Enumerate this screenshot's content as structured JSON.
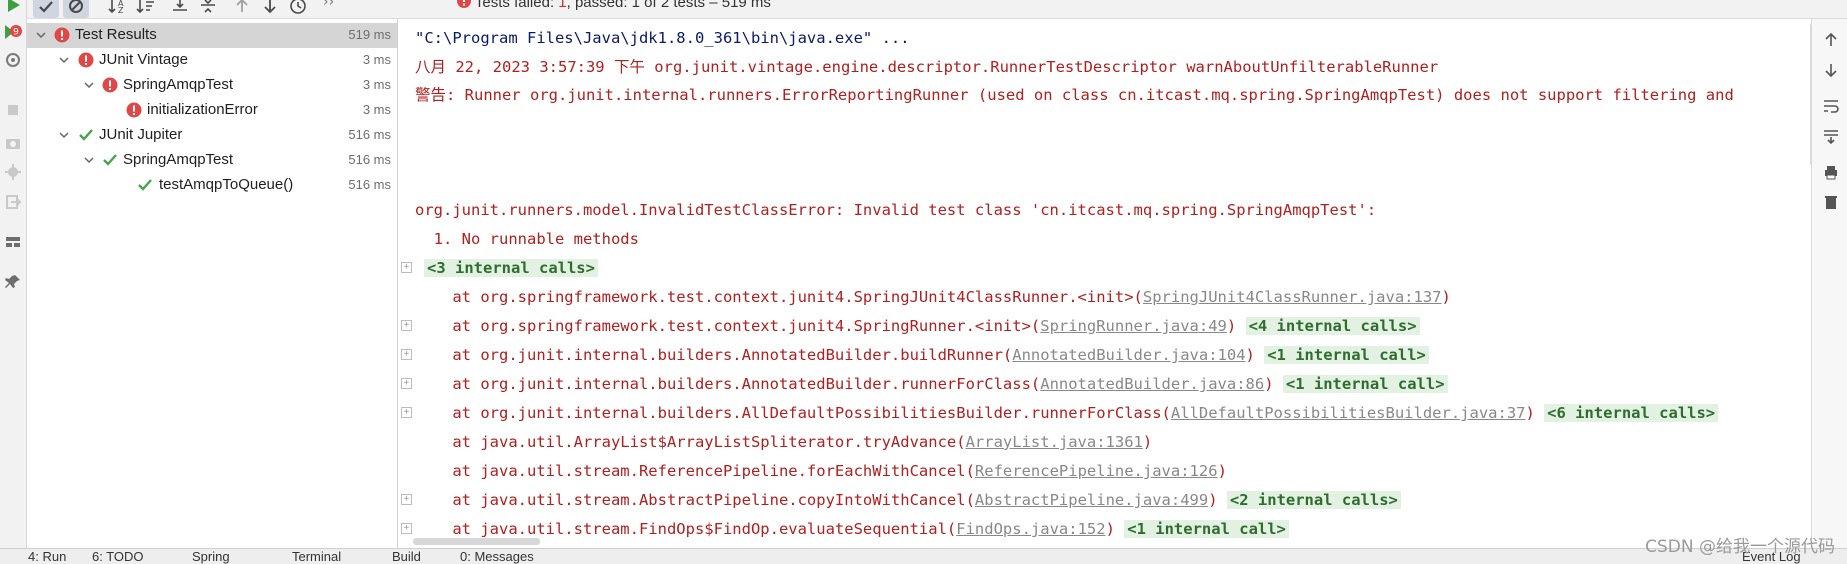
{
  "toolbar": {
    "status_prefix": "Tests failed: ",
    "failed_count": "1",
    "status_middle": ", passed: ",
    "passed_count": "1",
    "status_suffix": " of 2 tests – 519 ms"
  },
  "tree": {
    "rows": [
      {
        "label": "Test Results",
        "duration": "519 ms",
        "status": "failed"
      },
      {
        "label": "JUnit Vintage",
        "duration": "3 ms",
        "status": "failed"
      },
      {
        "label": "SpringAmqpTest",
        "duration": "3 ms",
        "status": "failed"
      },
      {
        "label": "initializationError",
        "duration": "3 ms",
        "status": "failed"
      },
      {
        "label": "JUnit Jupiter",
        "duration": "516 ms",
        "status": "passed"
      },
      {
        "label": "SpringAmqpTest",
        "duration": "516 ms",
        "status": "passed"
      },
      {
        "label": "testAmqpToQueue()",
        "duration": "516 ms",
        "status": "passed"
      }
    ]
  },
  "console": {
    "cmd": "\"C:\\Program Files\\Java\\jdk1.8.0_361\\bin\\java.exe\" ...",
    "warn1": "八月 22, 2023 3:57:39 下午 org.junit.vintage.engine.descriptor.RunnerTestDescriptor warnAboutUnfilterableRunner",
    "warn2": "警告: Runner org.junit.internal.runners.ErrorReportingRunner (used on class cn.itcast.mq.spring.SpringAmqpTest) does not support filtering and",
    "error": "org.junit.runners.model.InvalidTestClassError: Invalid test class 'cn.itcast.mq.spring.SpringAmqpTest':",
    "reason": "  1. No runnable methods",
    "internal_first": "<3 internal calls>",
    "frames": [
      {
        "pre": "    at org.springframework.test.context.junit4.SpringJUnit4ClassRunner.<init>(",
        "link": "SpringJUnit4ClassRunner.java:137",
        "post": ")",
        "internal": ""
      },
      {
        "pre": "    at org.springframework.test.context.junit4.SpringRunner.<init>(",
        "link": "SpringRunner.java:49",
        "post": ")",
        "internal": "<4 internal calls>"
      },
      {
        "pre": "    at org.junit.internal.builders.AnnotatedBuilder.buildRunner(",
        "link": "AnnotatedBuilder.java:104",
        "post": ")",
        "internal": "<1 internal call>"
      },
      {
        "pre": "    at org.junit.internal.builders.AnnotatedBuilder.runnerForClass(",
        "link": "AnnotatedBuilder.java:86",
        "post": ")",
        "internal": "<1 internal call>"
      },
      {
        "pre": "    at org.junit.internal.builders.AllDefaultPossibilitiesBuilder.runnerForClass(",
        "link": "AllDefaultPossibilitiesBuilder.java:37",
        "post": ")",
        "internal": "<6 internal calls>"
      },
      {
        "pre": "    at java.util.ArrayList$ArrayListSpliterator.tryAdvance(",
        "link": "ArrayList.java:1361",
        "post": ")",
        "internal": ""
      },
      {
        "pre": "    at java.util.stream.ReferencePipeline.forEachWithCancel(",
        "link": "ReferencePipeline.java:126",
        "post": ")",
        "internal": ""
      },
      {
        "pre": "    at java.util.stream.AbstractPipeline.copyIntoWithCancel(",
        "link": "AbstractPipeline.java:499",
        "post": ")",
        "internal": "<2 internal calls>"
      },
      {
        "pre": "    at java.util.stream.FindOps$FindOp.evaluateSequential(",
        "link": "FindOps.java:152",
        "post": ")",
        "internal": "<1 internal call>"
      }
    ]
  },
  "bottom": {
    "tabs": [
      "4: Run",
      "6: TODO",
      "Spring",
      "Terminal",
      "Build",
      "0: Messages"
    ],
    "event_log": "Event Log"
  },
  "watermark": "CSDN @给我一个源代码",
  "colors": {
    "fail": "#e04848",
    "pass": "#4aa24a",
    "internal_bg": "#e3f1e3"
  }
}
